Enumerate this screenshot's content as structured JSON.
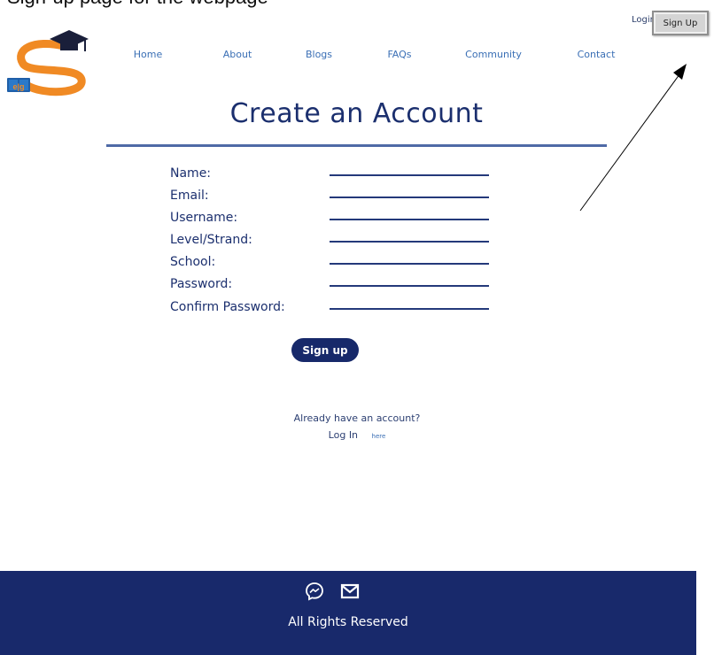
{
  "caption": "Sign-up page for the webpage",
  "header": {
    "nav": [
      "Home",
      "About",
      "Blogs",
      "FAQs",
      "Community",
      "Contact"
    ],
    "login_label": "Login",
    "signup_label": "Sign Up"
  },
  "logo": {
    "badge_text": "e|g"
  },
  "main": {
    "title": "Create an Account",
    "fields": [
      {
        "label": "Name:",
        "value": ""
      },
      {
        "label": "Email:",
        "value": ""
      },
      {
        "label": "Username:",
        "value": ""
      },
      {
        "label": "Level/Strand:",
        "value": ""
      },
      {
        "label": "School:",
        "value": ""
      },
      {
        "label": "Password:",
        "value": ""
      },
      {
        "label": "Confirm Password:",
        "value": ""
      }
    ],
    "submit_label": "Sign up",
    "already_text": "Already have an account?",
    "login_text": "Log In",
    "here_text": "here"
  },
  "footer": {
    "text": "All Rights Reserved",
    "icons": [
      "messenger-icon",
      "mail-icon"
    ]
  },
  "colors": {
    "navy": "#18296b",
    "title": "#1b2f6e",
    "nav_link": "#3a6fb5",
    "logo_orange": "#f08a24",
    "logo_blue": "#1f5fa8"
  }
}
